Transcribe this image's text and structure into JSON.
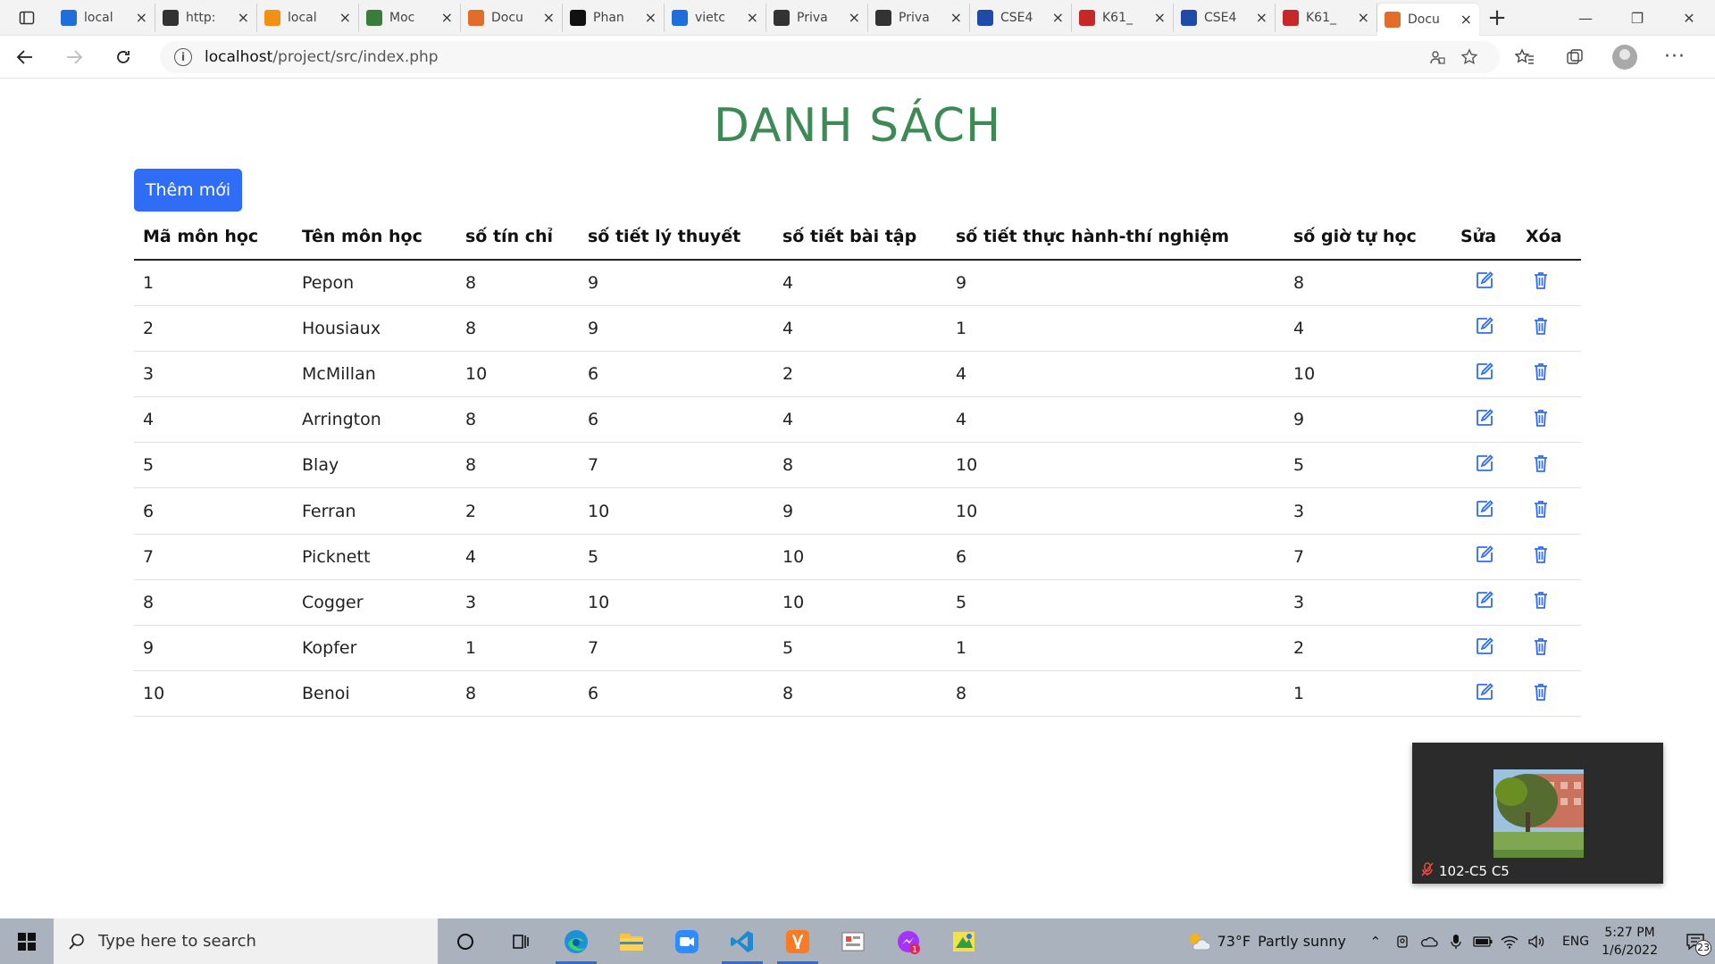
{
  "browser": {
    "tabs": [
      {
        "label": "local",
        "icon": "bing-icon",
        "color": "#1e6fd9"
      },
      {
        "label": "http:",
        "icon": "laptop-icon",
        "color": "#333333"
      },
      {
        "label": "local",
        "icon": "phpmyadmin-icon",
        "color": "#f29111"
      },
      {
        "label": "Moc",
        "icon": "bird-icon",
        "color": "#3a7d3a"
      },
      {
        "label": "Docu",
        "icon": "xampp-icon",
        "color": "#e26d2a"
      },
      {
        "label": "Phan",
        "icon": "github-icon",
        "color": "#111111"
      },
      {
        "label": "vietc",
        "icon": "bing-icon",
        "color": "#1e6fd9"
      },
      {
        "label": "Priva",
        "icon": "private-doc-icon",
        "color": "#333333"
      },
      {
        "label": "Priva",
        "icon": "private-doc-icon",
        "color": "#333333"
      },
      {
        "label": "CSE4",
        "icon": "dots-icon",
        "color": "#1f4aa8"
      },
      {
        "label": "K61_",
        "icon": "pdf-icon",
        "color": "#c62828"
      },
      {
        "label": "CSE4",
        "icon": "dots-icon",
        "color": "#1f4aa8"
      },
      {
        "label": "K61_",
        "icon": "pdf-icon",
        "color": "#c62828"
      },
      {
        "label": "Docu",
        "icon": "xampp-icon",
        "color": "#e26d2a",
        "active": true
      }
    ],
    "url_host": "localhost",
    "url_path": "/project/src/index.php"
  },
  "page": {
    "title": "DANH SÁCH",
    "add_button": "Thêm mới",
    "accent_color": "#3d8a56",
    "button_color": "#2f6df6",
    "columns": [
      "Mã môn học",
      "Tên môn học",
      "số tín chỉ",
      "số tiết lý thuyết",
      "số tiết bài tập",
      "số tiết thực hành-thí nghiệm",
      "số giờ tự học",
      "Sửa",
      "Xóa"
    ],
    "rows": [
      {
        "id": "1",
        "name": "Pepon",
        "credits": "8",
        "theory": "9",
        "exercise": "4",
        "practice": "9",
        "self_study": "8"
      },
      {
        "id": "2",
        "name": "Housiaux",
        "credits": "8",
        "theory": "9",
        "exercise": "4",
        "practice": "1",
        "self_study": "4"
      },
      {
        "id": "3",
        "name": "McMillan",
        "credits": "10",
        "theory": "6",
        "exercise": "2",
        "practice": "4",
        "self_study": "10"
      },
      {
        "id": "4",
        "name": "Arrington",
        "credits": "8",
        "theory": "6",
        "exercise": "4",
        "practice": "4",
        "self_study": "9"
      },
      {
        "id": "5",
        "name": "Blay",
        "credits": "8",
        "theory": "7",
        "exercise": "8",
        "practice": "10",
        "self_study": "5"
      },
      {
        "id": "6",
        "name": "Ferran",
        "credits": "2",
        "theory": "10",
        "exercise": "9",
        "practice": "10",
        "self_study": "3"
      },
      {
        "id": "7",
        "name": "Picknett",
        "credits": "4",
        "theory": "5",
        "exercise": "10",
        "practice": "6",
        "self_study": "7"
      },
      {
        "id": "8",
        "name": "Cogger",
        "credits": "3",
        "theory": "10",
        "exercise": "10",
        "practice": "5",
        "self_study": "3"
      },
      {
        "id": "9",
        "name": "Kopfer",
        "credits": "1",
        "theory": "7",
        "exercise": "5",
        "practice": "1",
        "self_study": "2"
      },
      {
        "id": "10",
        "name": "Benoi",
        "credits": "8",
        "theory": "6",
        "exercise": "8",
        "practice": "8",
        "self_study": "1"
      }
    ]
  },
  "pip": {
    "caption": "102-C5 C5"
  },
  "taskbar": {
    "search_placeholder": "Type here to search",
    "weather_temp": "73°F",
    "weather_text": "Partly sunny",
    "language": "ENG",
    "time": "5:27 PM",
    "date": "1/6/2022",
    "notification_count": "23"
  }
}
